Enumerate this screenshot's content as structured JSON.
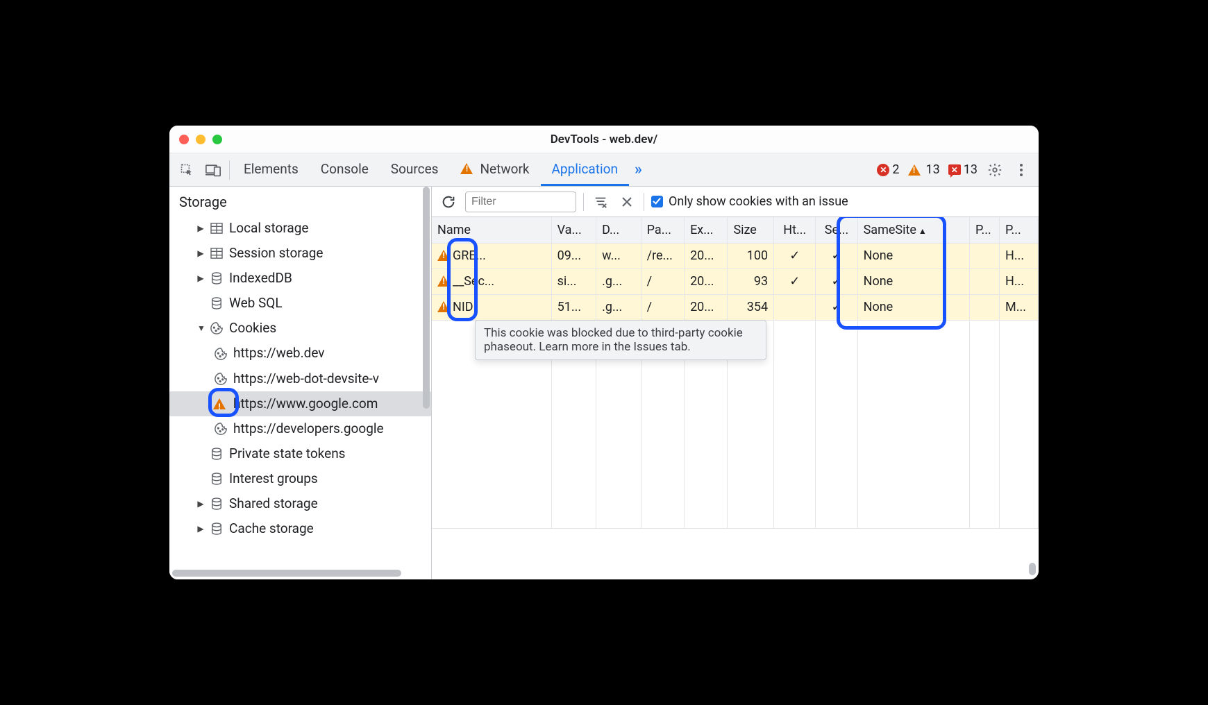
{
  "window": {
    "title": "DevTools - web.dev/"
  },
  "tabs": {
    "elements": "Elements",
    "console": "Console",
    "sources": "Sources",
    "network": "Network",
    "application": "Application"
  },
  "status": {
    "errors": "2",
    "warnings": "13",
    "messages": "13"
  },
  "sidebar": {
    "heading": "Storage",
    "local": "Local storage",
    "session": "Session storage",
    "indexed": "IndexedDB",
    "websql": "Web SQL",
    "cookies": "Cookies",
    "cookie_origins": {
      "webdev": "https://web.dev",
      "devsite": "https://web-dot-devsite-v",
      "google": "https://www.google.com",
      "devs": "https://developers.google"
    },
    "pst": "Private state tokens",
    "interest": "Interest groups",
    "shared": "Shared storage",
    "cache": "Cache storage"
  },
  "toolbar": {
    "filter_placeholder": "Filter",
    "only_issues_label": "Only show cookies with an issue"
  },
  "table": {
    "headers": {
      "name": "Name",
      "value": "Va...",
      "domain": "D...",
      "path": "Pa...",
      "expires": "Ex...",
      "size": "Size",
      "http": "Ht...",
      "secure": "Se...",
      "samesite": "SameSite",
      "pk": "P...",
      "priority": "P..."
    },
    "rows": [
      {
        "name": "GRE...",
        "value": "09...",
        "domain": "w...",
        "path": "/re...",
        "expires": "20...",
        "size": "100",
        "http": "✓",
        "secure": "✓",
        "samesite": "None",
        "pk": "",
        "priority": "H..."
      },
      {
        "name": "__Sec...",
        "value": "si...",
        "domain": ".g...",
        "path": "/",
        "expires": "20...",
        "size": "93",
        "http": "✓",
        "secure": "✓",
        "samesite": "None",
        "pk": "",
        "priority": "H..."
      },
      {
        "name": "NID",
        "value": "51...",
        "domain": ".g...",
        "path": "/",
        "expires": "20...",
        "size": "354",
        "http": "",
        "secure": "✓",
        "samesite": "None",
        "pk": "",
        "priority": "M..."
      }
    ]
  },
  "tooltip": "This cookie was blocked due to third-party cookie phaseout. Learn more in the Issues tab."
}
